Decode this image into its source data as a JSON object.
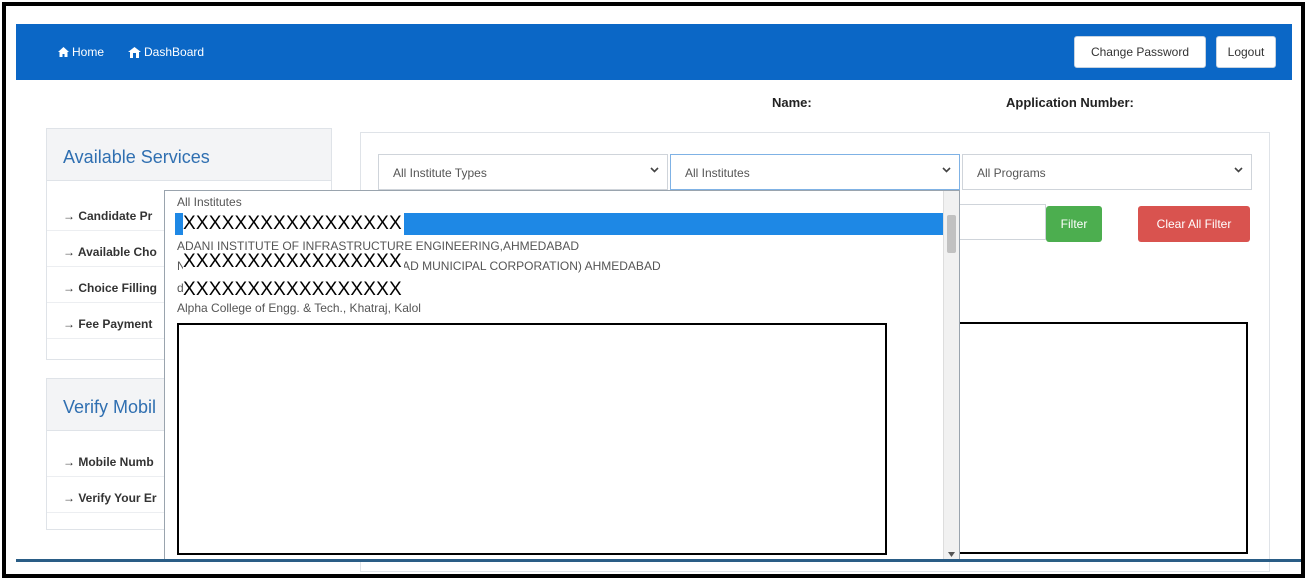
{
  "navbar": {
    "home_label": "Home",
    "dashboard_label": "DashBoard",
    "change_password_label": "Change Password",
    "logout_label": "Logout",
    "color": "#0b67c6"
  },
  "user_info": {
    "name_label": "Name:",
    "application_number_label": "Application Number:"
  },
  "available_services": {
    "title": "Available Services",
    "items": [
      "→ Candidate Pr",
      "→ Available Cho",
      "→ Choice Filling",
      "→ Fee Payment"
    ]
  },
  "verify_mobile": {
    "title": "Verify Mobil",
    "items": [
      "→ Mobile Numb",
      "→ Verify Your Er"
    ]
  },
  "filters": {
    "institute_types": "All Institute Types",
    "institutes": "All Institutes",
    "programs": "All Programs",
    "filter_button": "Filter",
    "clear_button": "Clear All Filter"
  },
  "dropdown": {
    "header_option": "All Institutes",
    "options": [
      "ADANI INSTITUTE OF INFRASTRUCTURE ENGINEERING,AHMEDABAD",
      "NOLOGY (WITHIN LIMITS OF AHMEDABAD MUNICIPAL CORPORATION) AHMEDABAD",
      "d",
      "Alpha College of Engg. & Tech., Khatraj, Kalol"
    ],
    "redacted": [
      "XXXXXXXXXXXXXXXXX",
      "XXXXXXXXXXXXXXXXX",
      "XXXXXXXXXXXXXXXXX"
    ],
    "highlight_color": "#1e88e5"
  },
  "colors": {
    "filter_button": "#4cae4f",
    "clear_button": "#d9534f",
    "panel_title": "#2f6fb1"
  }
}
